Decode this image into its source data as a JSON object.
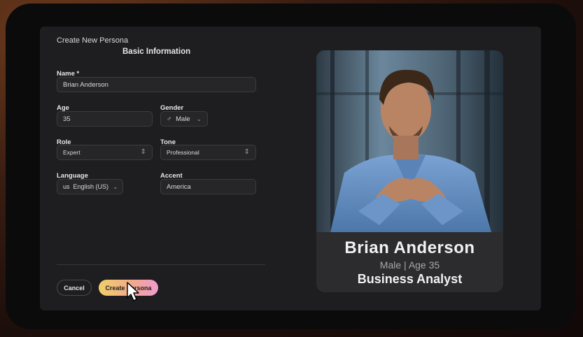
{
  "dialog": {
    "title": "Create New Persona",
    "section_title": "Basic Information"
  },
  "form": {
    "name": {
      "label": "Name *",
      "value": "Brian Anderson"
    },
    "age": {
      "label": "Age",
      "value": "35"
    },
    "gender": {
      "label": "Gender",
      "symbol": "♂",
      "value": "Male"
    },
    "role": {
      "label": "Role",
      "value": "Expert"
    },
    "tone": {
      "label": "Tone",
      "value": "Professional"
    },
    "language": {
      "label": "Language",
      "prefix": "us",
      "value": "English (US)"
    },
    "accent": {
      "label": "Accent",
      "value": "America"
    }
  },
  "actions": {
    "cancel_label": "Cancel",
    "create_label": "Create Persona"
  },
  "preview": {
    "name": "Brian Anderson",
    "gender": "Male",
    "age_label": "Age",
    "age": "35",
    "role": "Business Analyst"
  },
  "colors": {
    "background": "#1e1e20",
    "field": "#262628",
    "create_gradient_start": "#f1cf6a",
    "create_gradient_end": "#f09ad0"
  }
}
